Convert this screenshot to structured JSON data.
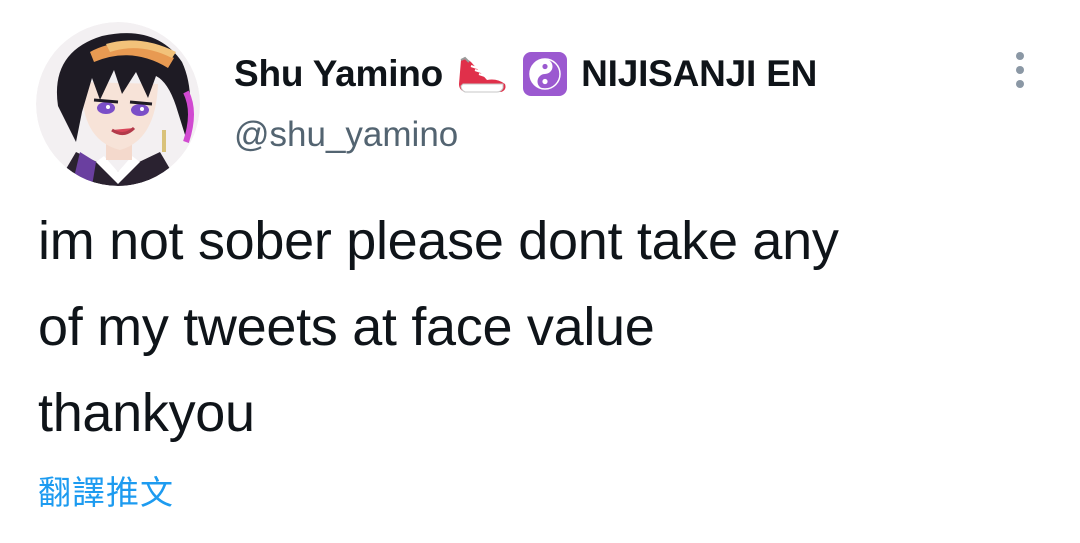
{
  "author": {
    "display_name": "Shu Yamino",
    "badges": [
      "sneaker-icon",
      "yin-yang-icon"
    ],
    "affiliation": "NIJISANJI EN",
    "handle": "@shu_yamino"
  },
  "tweet": {
    "lines": [
      "im not sober please dont take any",
      "of my tweets at face value",
      "thankyou"
    ]
  },
  "actions": {
    "translate_label": "翻譯推文",
    "more_icon": "more-vertical-icon"
  },
  "colors": {
    "text_primary": "#0f1419",
    "text_secondary": "#536471",
    "link": "#1d9bf0",
    "yin_yang_badge": "#9b59d0",
    "sneaker": "#e0304a"
  }
}
